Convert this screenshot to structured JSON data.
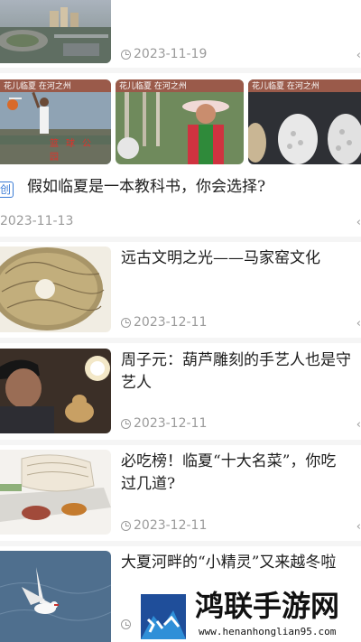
{
  "articles": [
    {
      "date": "2023-11-19"
    },
    {
      "tag": "创",
      "title": "假如临夏是一本教科书，你会选择?",
      "date": "2023-11-13",
      "image_captions": [
        "花儿临夏 在河之州",
        "花儿临夏 在河之州",
        "花儿临夏 在河之州"
      ],
      "sign_text": "篮球公园"
    },
    {
      "title_lines": [
        "远古文明之光——马家窑文化"
      ],
      "date": "2023-12-11"
    },
    {
      "title_lines": [
        "周子元：葫芦雕刻的手艺人也是守",
        "艺人"
      ],
      "date": "2023-12-11"
    },
    {
      "title_lines": [
        "必吃榜！临夏“十大名菜”，你吃",
        "过几道?"
      ],
      "date": "2023-12-11"
    },
    {
      "title_lines": [
        "大夏河畔的“小精灵”又来越冬啦"
      ],
      "date": ""
    }
  ],
  "watermark": {
    "brand": "鸿联手游网",
    "url": "www.henanhonglian95.com"
  },
  "icons": {
    "clock": "clock-icon",
    "more": "more-icon"
  }
}
